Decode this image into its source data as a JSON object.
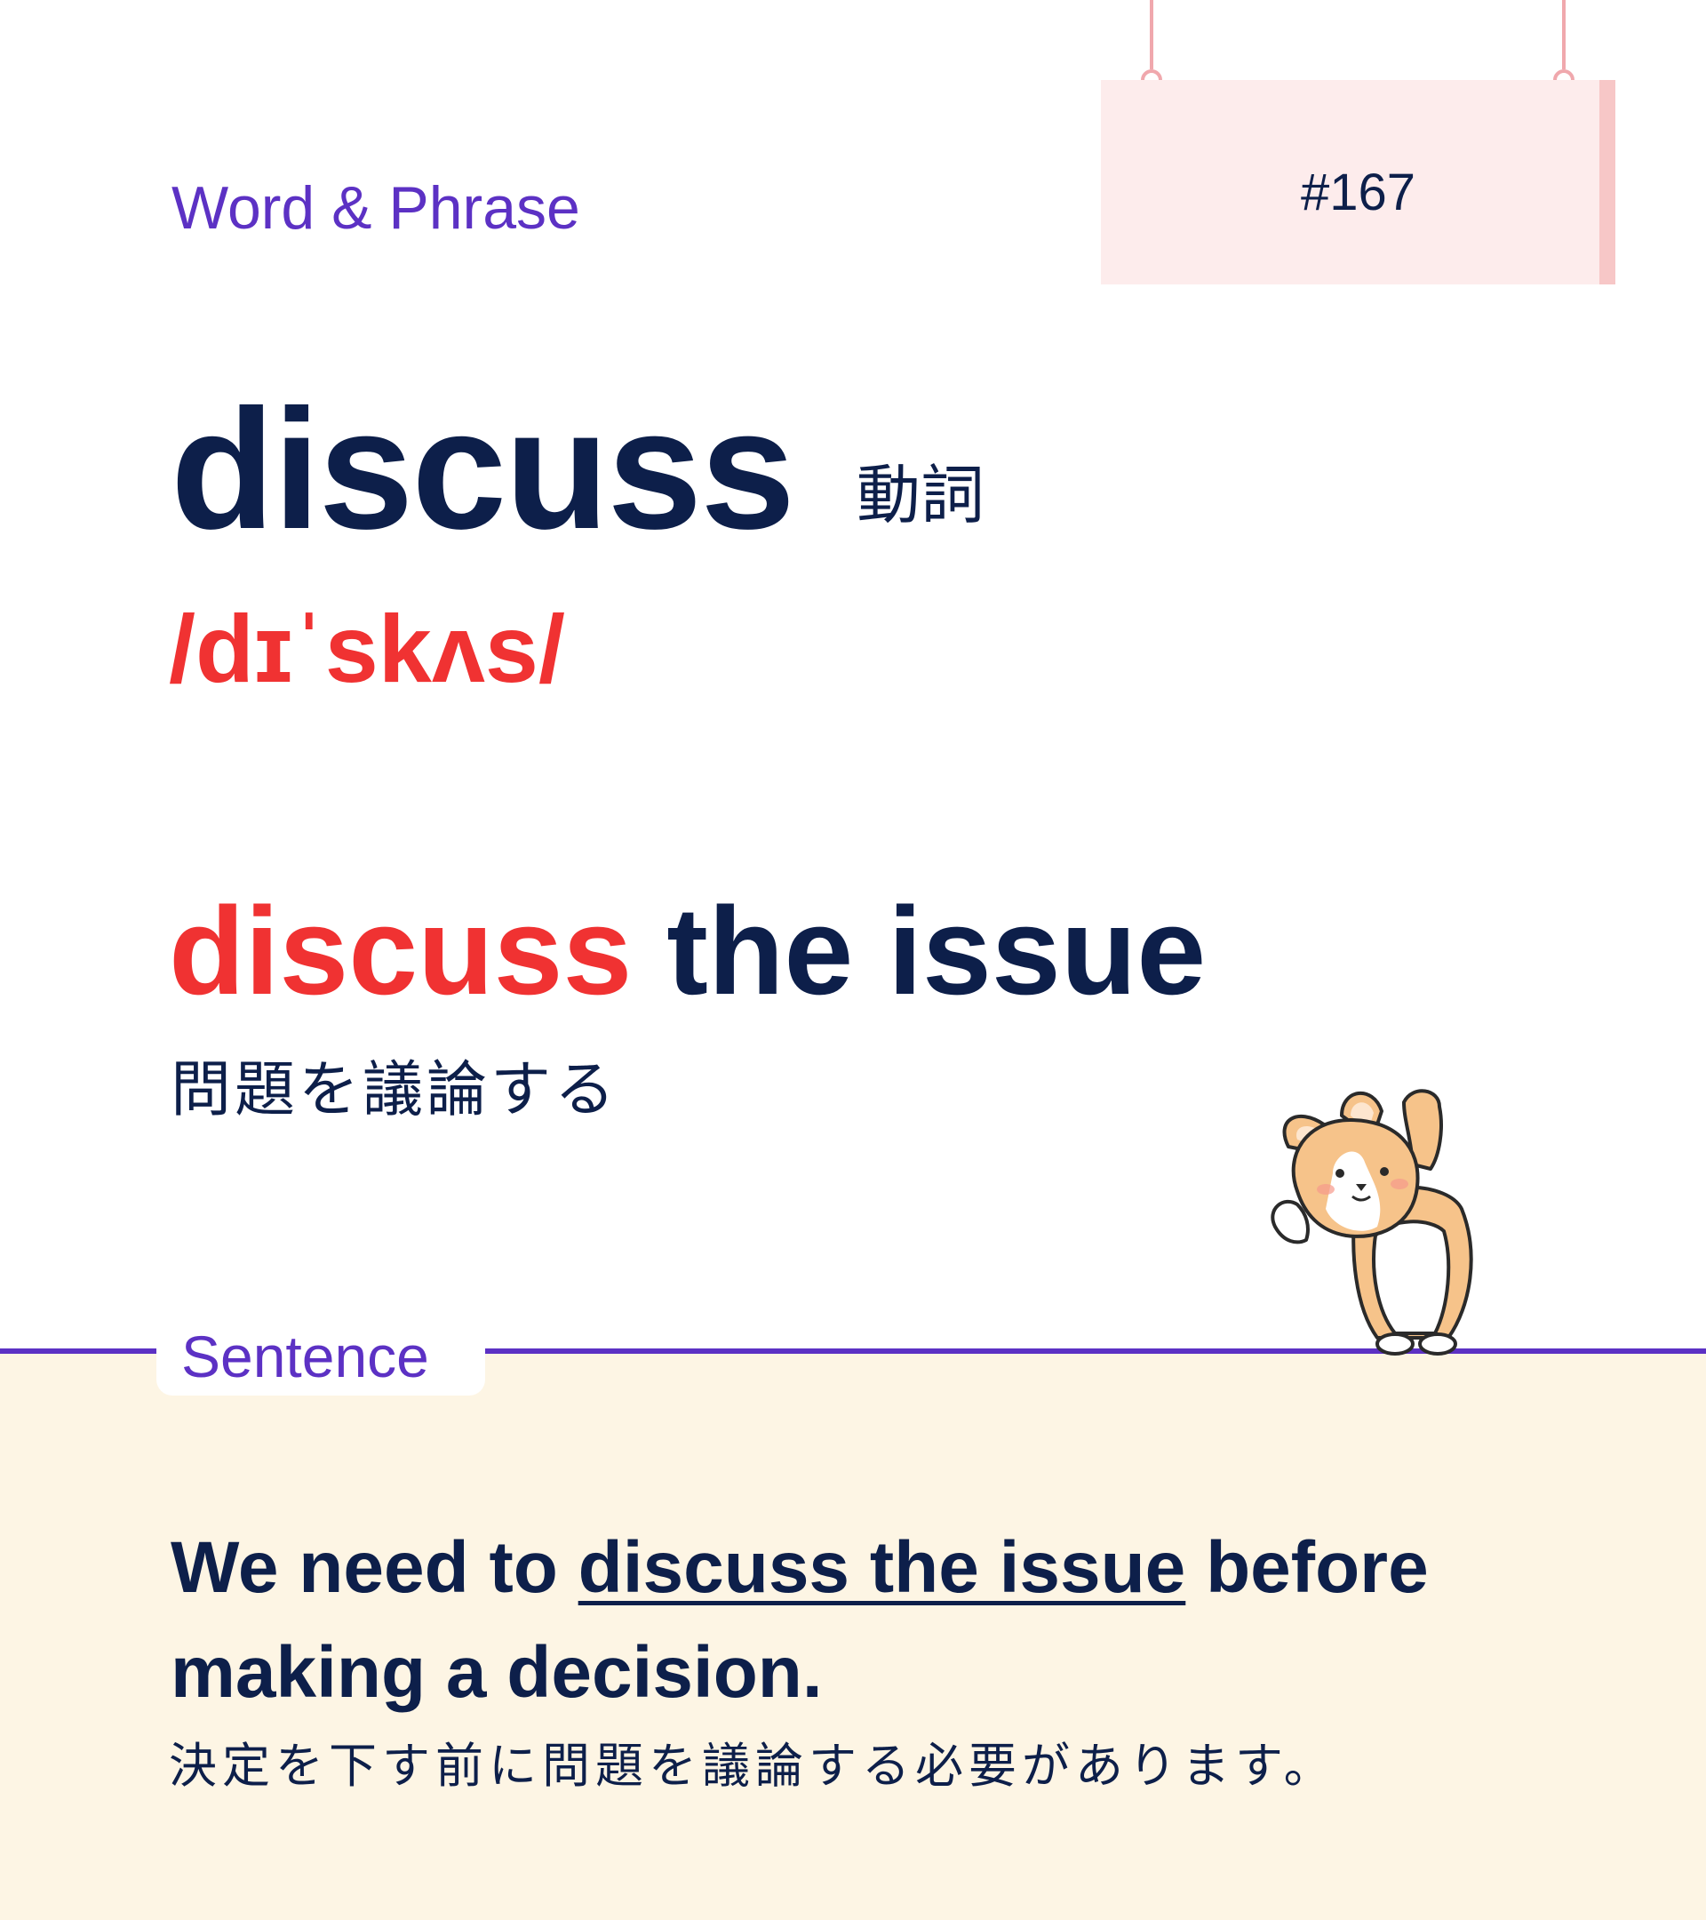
{
  "card": {
    "category": "Word & Phrase",
    "number": "#167",
    "headword": "discuss",
    "part_of_speech": "動詞",
    "pronunciation": "/dɪˈskʌs/",
    "phrase": {
      "highlight": "discuss",
      "rest": " the issue"
    },
    "phrase_translation": "問題を議論する",
    "sentence_label": "Sentence",
    "sentence": {
      "before": "We need to ",
      "underlined": "discuss the issue",
      "after": " before making a decision."
    },
    "sentence_translation": "決定を下す前に問題を議論する必要があります。"
  },
  "colors": {
    "navy": "#0d1f4a",
    "accent_red": "#f03232",
    "purple": "#5c31c4",
    "sign_pink": "#fdecec",
    "panel_cream": "#fdf5e4"
  },
  "illustration": {
    "icon": "corgi-mascot"
  }
}
